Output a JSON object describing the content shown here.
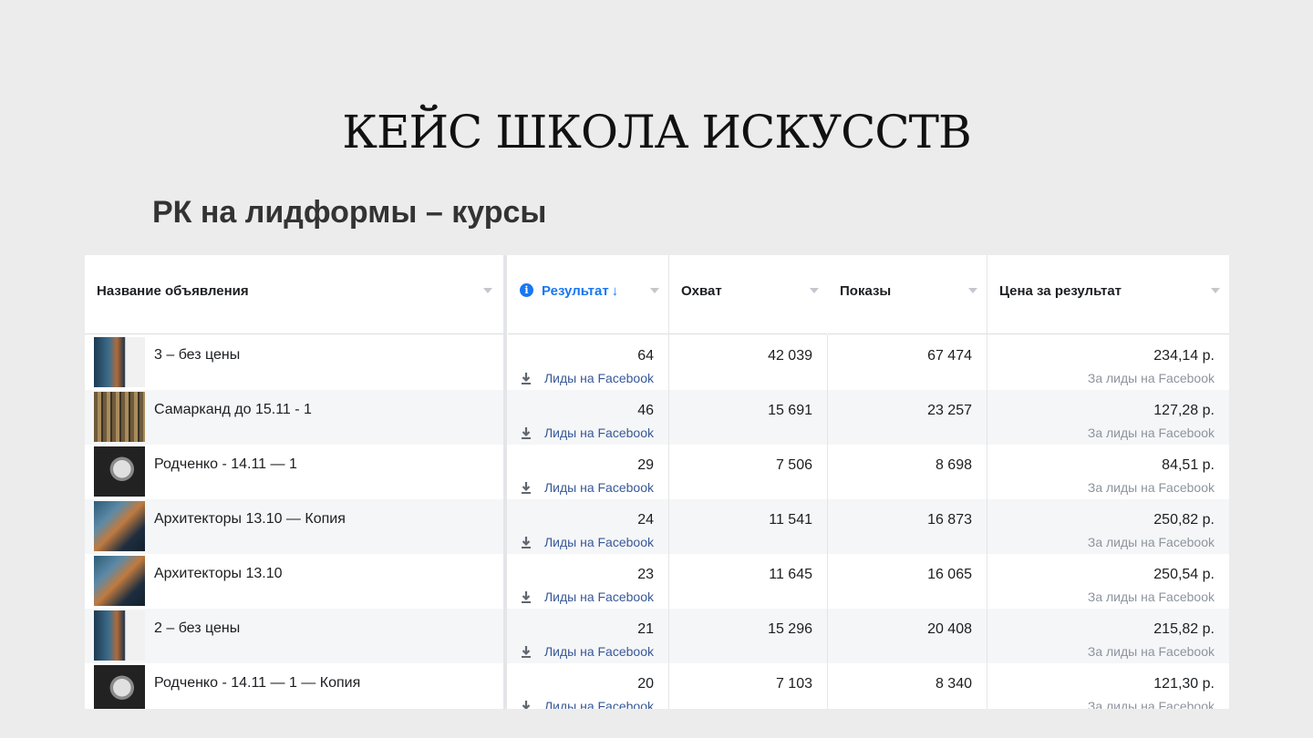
{
  "slide": {
    "title": "КЕЙС ШКОЛА ИСКУССТВ",
    "subtitle": "РК на лидформы – курсы"
  },
  "table": {
    "columns": [
      {
        "label": "Название объявления"
      },
      {
        "label": "Результат",
        "arrow": "↓",
        "info_icon": "info-icon",
        "active": true
      },
      {
        "label": "Охват"
      },
      {
        "label": "Показы"
      },
      {
        "label": "Цена за результат"
      }
    ],
    "result_sub_label": "Лиды на Facebook",
    "cost_sub_label": "За лиды на Facebook",
    "accent_color": "#1877f2",
    "rows": [
      {
        "name": "3 – без цены",
        "result": "64",
        "reach": "42 039",
        "impressions": "67 474",
        "cost": "234,14 р.",
        "thumb": "poster-architecture-white"
      },
      {
        "name": "Самарканд до 15.11 - 1",
        "result": "46",
        "reach": "15 691",
        "impressions": "23 257",
        "cost": "127,28 р.",
        "thumb": "poster-samarkand"
      },
      {
        "name": "Родченко - 14.11 — 1",
        "result": "29",
        "reach": "7 506",
        "impressions": "8 698",
        "cost": "84,51 р.",
        "thumb": "poster-rodchenko"
      },
      {
        "name": "Архитекторы 13.10 — Копия",
        "result": "24",
        "reach": "11 541",
        "impressions": "16 873",
        "cost": "250,82 р.",
        "thumb": "poster-architecture"
      },
      {
        "name": "Архитекторы 13.10",
        "result": "23",
        "reach": "11 645",
        "impressions": "16 065",
        "cost": "250,54 р.",
        "thumb": "poster-architecture"
      },
      {
        "name": "2 – без цены",
        "result": "21",
        "reach": "15 296",
        "impressions": "20 408",
        "cost": "215,82 р.",
        "thumb": "poster-architecture-white"
      },
      {
        "name": "Родченко - 14.11 — 1 — Копия",
        "result": "20",
        "reach": "7 103",
        "impressions": "8 340",
        "cost": "121,30 р.",
        "thumb": "poster-rodchenko"
      }
    ]
  }
}
